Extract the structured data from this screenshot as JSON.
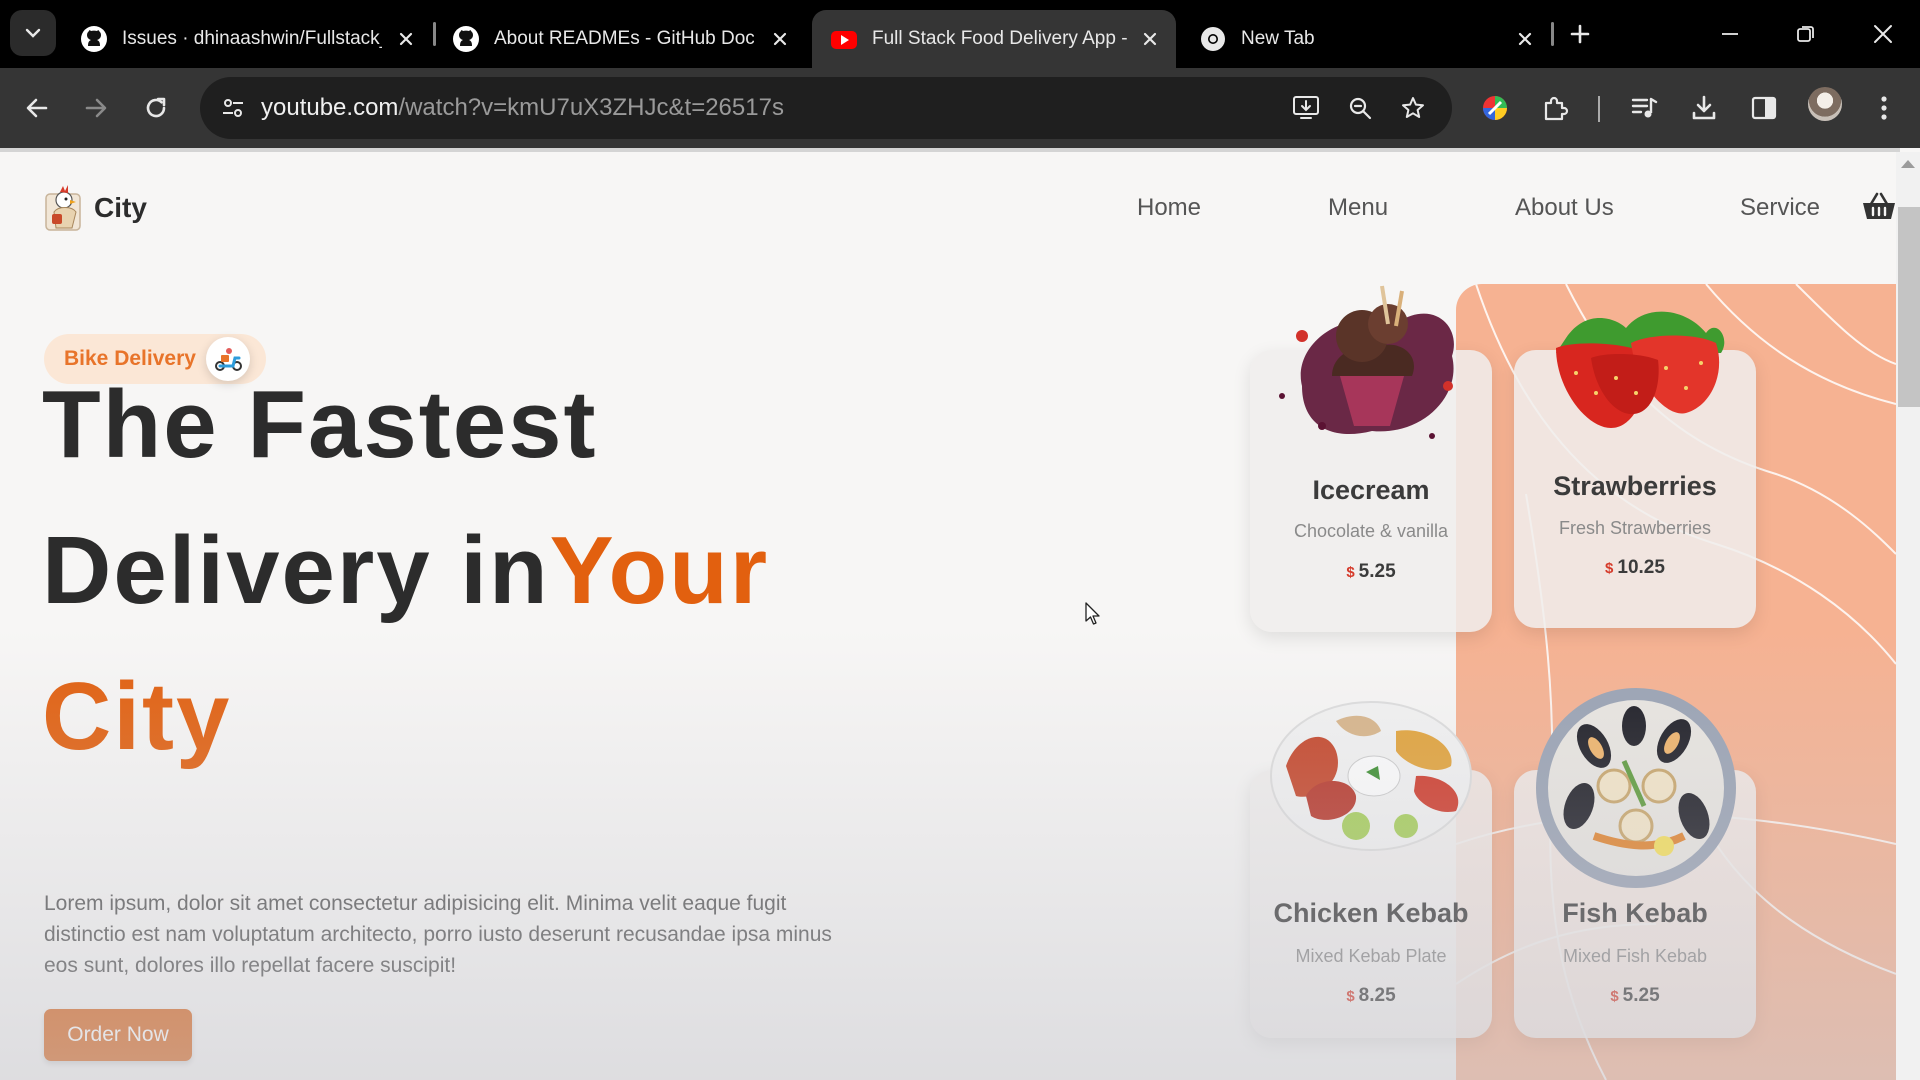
{
  "browser": {
    "tabs": [
      {
        "title": "Issues · dhinaashwin/Fullstack_f",
        "icon": "github-icon",
        "active": false
      },
      {
        "title": "About READMEs - GitHub Docs",
        "icon": "github-icon",
        "active": false
      },
      {
        "title": "Full Stack Food Delivery App - F",
        "icon": "youtube-icon",
        "active": true
      },
      {
        "title": "New Tab",
        "icon": "chrome-icon",
        "active": false
      }
    ],
    "url_host": "youtube.com",
    "url_path": "/watch?v=kmU7uX3ZHJc&t=26517s"
  },
  "site": {
    "brand": "City",
    "nav": [
      "Home",
      "Menu",
      "About Us",
      "Service"
    ],
    "badge": "Bike Delivery",
    "headline": {
      "line1": "The Fastest",
      "line2": "Delivery in",
      "line2_accent": "Your",
      "line3_accent": "City"
    },
    "lead": "Lorem ipsum, dolor sit amet consectetur adipisicing elit. Minima velit eaque fugit distinctio est nam voluptatum architecto, porro iusto deserunt recusandae ipsa minus eos sunt, dolores illo repellat facere suscipit!",
    "cta": "Order Now",
    "currency_symbol": "$",
    "cards": [
      {
        "name": "Icecream",
        "description": "Chocolate & vanilla",
        "price": "5.25",
        "image": "icecream-image"
      },
      {
        "name": "Strawberries",
        "description": "Fresh Strawberries",
        "price": "10.25",
        "image": "strawberries-image"
      },
      {
        "name": "Chicken Kebab",
        "description": "Mixed Kebab Plate",
        "price": "8.25",
        "image": "chicken-kebab-image"
      },
      {
        "name": "Fish Kebab",
        "description": "Mixed Fish Kebab",
        "price": "5.25",
        "image": "fish-kebab-image"
      }
    ]
  },
  "colors": {
    "accent": "#e2600f",
    "badge_bg": "#fbe7d6",
    "panel_bg": "#f6b292",
    "button_bg": "#d9651c"
  }
}
